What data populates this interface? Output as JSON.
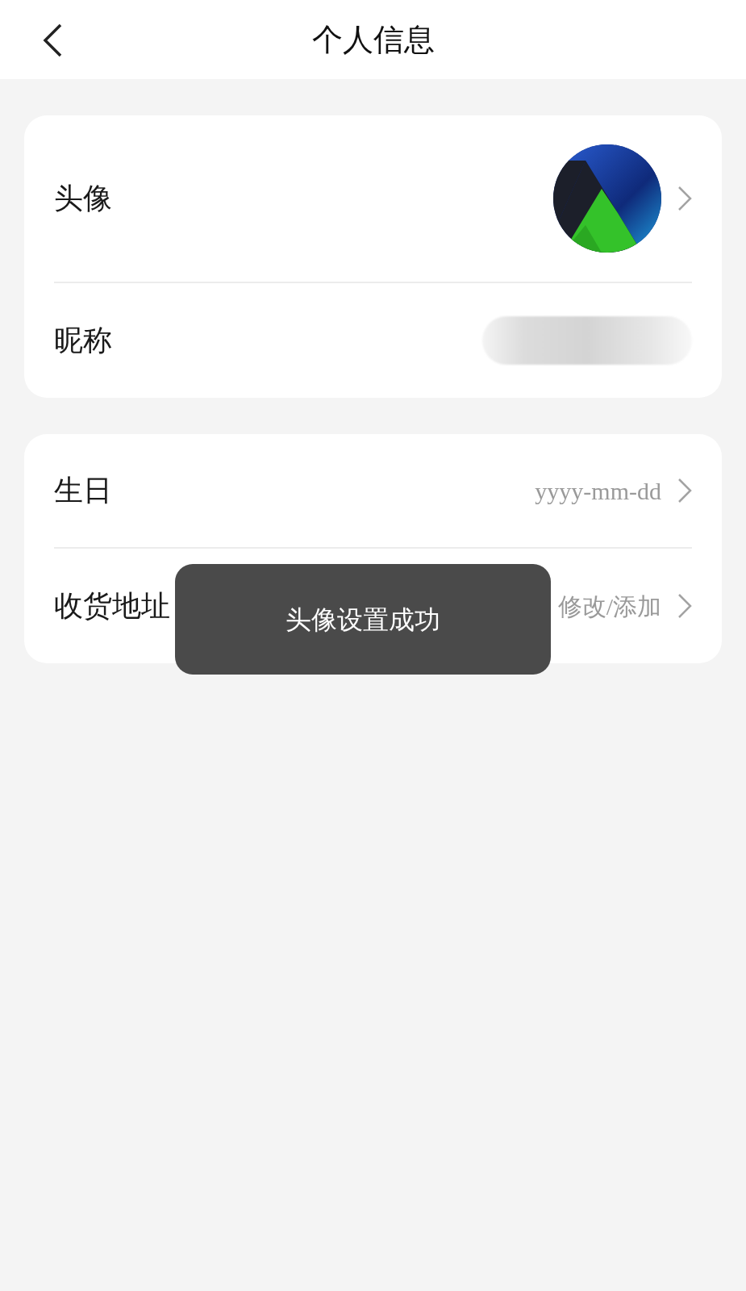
{
  "header": {
    "title": "个人信息"
  },
  "sections": [
    {
      "rows": [
        {
          "kind": "avatar",
          "label": "头像"
        },
        {
          "kind": "blurred",
          "label": "昵称"
        }
      ]
    },
    {
      "rows": [
        {
          "kind": "value",
          "label": "生日",
          "value": "yyyy-mm-dd"
        },
        {
          "kind": "value",
          "label": "收货地址",
          "value": "修改/添加"
        }
      ]
    }
  ],
  "toast": {
    "text": "头像设置成功"
  }
}
